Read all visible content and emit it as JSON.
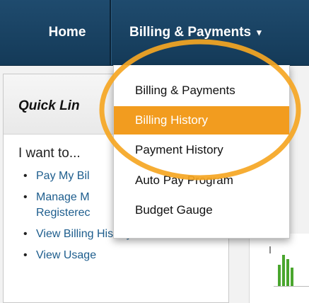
{
  "nav": {
    "home_label": "Home",
    "billing_label": "Billing & Payments",
    "caret": "▾"
  },
  "quick_links": {
    "title": "Quick Lin",
    "want_to": "I want to...",
    "items": [
      {
        "label": "Pay My Bil"
      },
      {
        "label": "Manage M"
      },
      {
        "label": "Registerec"
      },
      {
        "label": "View Billing History"
      },
      {
        "label": "View Usage"
      }
    ]
  },
  "dropdown": {
    "items": [
      {
        "label": "Billing & Payments",
        "selected": false
      },
      {
        "label": "Billing History",
        "selected": true
      },
      {
        "label": "Payment History",
        "selected": false
      },
      {
        "label": "Auto Pay Program",
        "selected": false
      },
      {
        "label": "Budget Gauge",
        "selected": false
      }
    ]
  },
  "colors": {
    "nav_bg": "#1a4465",
    "highlight": "#f29c1f",
    "link": "#1d5d8d",
    "annotation_ring": "#f5a623"
  }
}
